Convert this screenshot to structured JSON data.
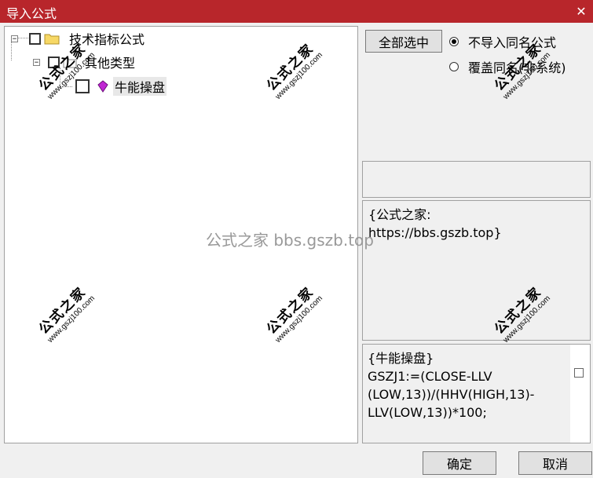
{
  "window": {
    "title": "导入公式",
    "close_glyph": "✕"
  },
  "tree": {
    "root_label": "技术指标公式",
    "group_label": "其他类型",
    "item_label": "牛能操盘",
    "expander_glyph": "−"
  },
  "actions": {
    "select_all_label": "全部选中",
    "option_no_import": "不导入同名公式",
    "option_overwrite": "覆盖同名(非系统)",
    "ok_label": "确定",
    "cancel_label": "取消"
  },
  "info_panel": {
    "lines": [
      "{公式之家:",
      "https://bbs.gszb.top}"
    ]
  },
  "code_panel": {
    "lines": [
      "{牛能操盘}",
      "GSZJ1:=(CLOSE-LLV",
      "(LOW,13))/(HHV(HIGH,13)-",
      "LLV(LOW,13))*100;"
    ]
  },
  "watermark": {
    "stamp_cn": "公式之家",
    "stamp_url": "www.gszj100.com",
    "center_text": "公式之家 bbs.gszb.top"
  }
}
